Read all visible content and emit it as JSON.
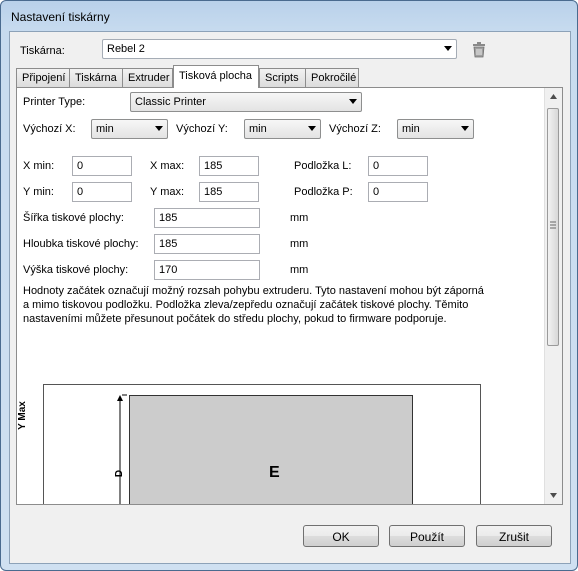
{
  "window": {
    "title": "Nastavení tiskárny"
  },
  "printer": {
    "label": "Tiskárna:",
    "value": "Rebel 2"
  },
  "tabs": [
    {
      "label": "Připojení"
    },
    {
      "label": "Tiskárna"
    },
    {
      "label": "Extruder"
    },
    {
      "label": "Tisková plocha",
      "active": true
    },
    {
      "label": "Scripts"
    },
    {
      "label": "Pokročilé"
    }
  ],
  "form": {
    "printer_type": {
      "label": "Printer Type:",
      "value": "Classic Printer"
    },
    "home_x": {
      "label": "Výchozí X:",
      "value": "min"
    },
    "home_y": {
      "label": "Výchozí Y:",
      "value": "min"
    },
    "home_z": {
      "label": "Výchozí Z:",
      "value": "min"
    },
    "xmin": {
      "label": "X min:",
      "value": "0"
    },
    "xmax": {
      "label": "X max:",
      "value": "185"
    },
    "bed_left": {
      "label": "Podložka L:",
      "value": "0"
    },
    "ymin": {
      "label": "Y min:",
      "value": "0"
    },
    "ymax": {
      "label": "Y max:",
      "value": "185"
    },
    "bed_front": {
      "label": "Podložka P:",
      "value": "0"
    },
    "width": {
      "label": "Šířka tiskové plochy:",
      "value": "185",
      "unit": "mm"
    },
    "depth": {
      "label": "Hloubka tiskové plochy:",
      "value": "185",
      "unit": "mm"
    },
    "height": {
      "label": "Výška tiskové plochy:",
      "value": "170",
      "unit": "mm"
    },
    "description": "Hodnoty začátek označují možný rozsah pohybu extruderu. Tyto nastavení mohou být záporná a mimo tiskovou podložku. Podložka zleva/zepředu označují začátek tiskové plochy. Těmito nastaveními můžete přesunout počátek do středu plochy, pokud to firmware podporuje."
  },
  "diagram": {
    "y_axis_label": "Y Max",
    "d_label": "D",
    "bed_label": "E"
  },
  "buttons": {
    "ok": "OK",
    "apply": "Použít",
    "cancel": "Zrušit"
  },
  "colors": {
    "title_bar": "#b9d1ea",
    "bed_fill": "#cccccc"
  },
  "icons": {
    "delete": "trash-icon",
    "dropdown": "chevron-down-icon"
  }
}
